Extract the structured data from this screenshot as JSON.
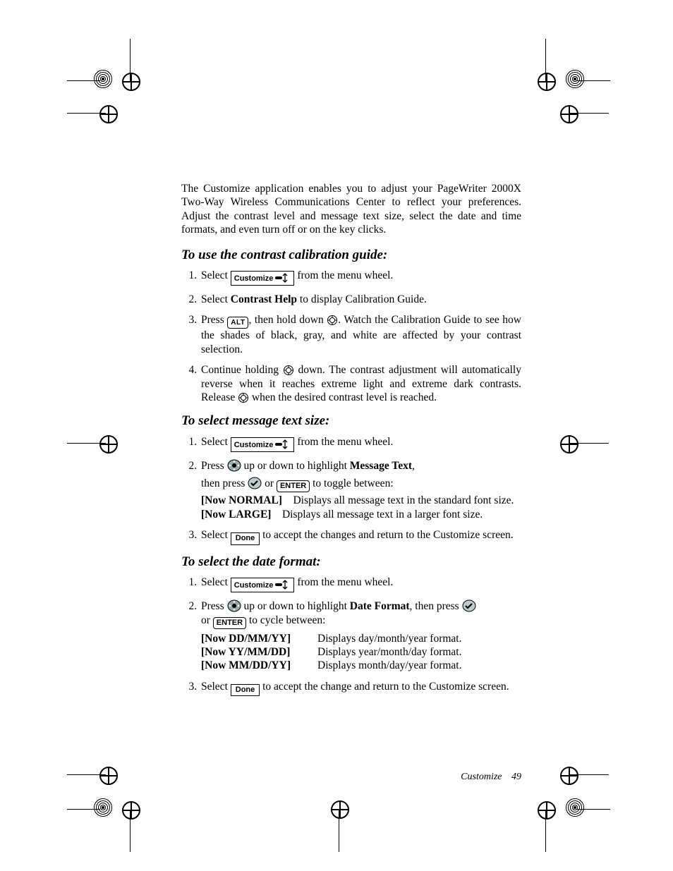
{
  "intro": "The Customize application enables you to adjust your PageWriter 2000X Two-Way Wireless Communications Center to reflect your preferences. Adjust the contrast level and message text size, select the date and time formats, and even turn off or on the key clicks.",
  "keys": {
    "customize": "Customize",
    "alt": "ALT",
    "enter": "ENTER",
    "done": "Done"
  },
  "section1": {
    "heading": "To use the contrast calibration guide:",
    "s1_a": "Select ",
    "s1_b": " from the menu wheel.",
    "s2_a": "Select ",
    "s2_bold": "Contrast Help",
    "s2_b": " to display Calibration Guide.",
    "s3_a": "Press ",
    "s3_b": ", then hold down ",
    "s3_c": ". Watch the Calibration Guide to see how the shades of black, gray, and white are affected by your contrast selection.",
    "s4_a": "Continue holding ",
    "s4_b": " down. The contrast adjustment will automatically reverse when it reaches extreme light and extreme dark contrasts. Release ",
    "s4_c": " when the desired contrast level is reached."
  },
  "section2": {
    "heading": "To select message text size:",
    "s1_a": "Select ",
    "s1_b": " from the menu wheel.",
    "s2_a": "Press ",
    "s2_b": " up or down to highlight ",
    "s2_bold": "Message Text",
    "s2_c": ",",
    "s2_d": "then press ",
    "s2_e": " or ",
    "s2_f": " to toggle between:",
    "opt1_label": "[Now NORMAL]",
    "opt1_desc": "Displays all message text in the standard font size.",
    "opt2_label": "[Now LARGE]",
    "opt2_desc": "Displays all message text in a larger font size.",
    "s3_a": "Select ",
    "s3_b": " to accept the changes and return to the Customize screen."
  },
  "section3": {
    "heading": "To select the date format:",
    "s1_a": "Select ",
    "s1_b": " from the menu wheel.",
    "s2_a": "Press ",
    "s2_b": " up or down to highlight ",
    "s2_bold": "Date Format",
    "s2_c": ", then press ",
    "s2_d": "or ",
    "s2_e": " to cycle between:",
    "fmt1_label": "[Now DD/MM/YY]",
    "fmt1_desc": "Displays day/month/year format.",
    "fmt2_label": "[Now YY/MM/DD]",
    "fmt2_desc": "Displays year/month/day format.",
    "fmt3_label": "[Now MM/DD/YY]",
    "fmt3_desc": "Displays month/day/year format.",
    "s3_a": "Select ",
    "s3_b": " to accept the change and return to the Customize screen."
  },
  "footer": {
    "section": "Customize",
    "page": "49"
  }
}
